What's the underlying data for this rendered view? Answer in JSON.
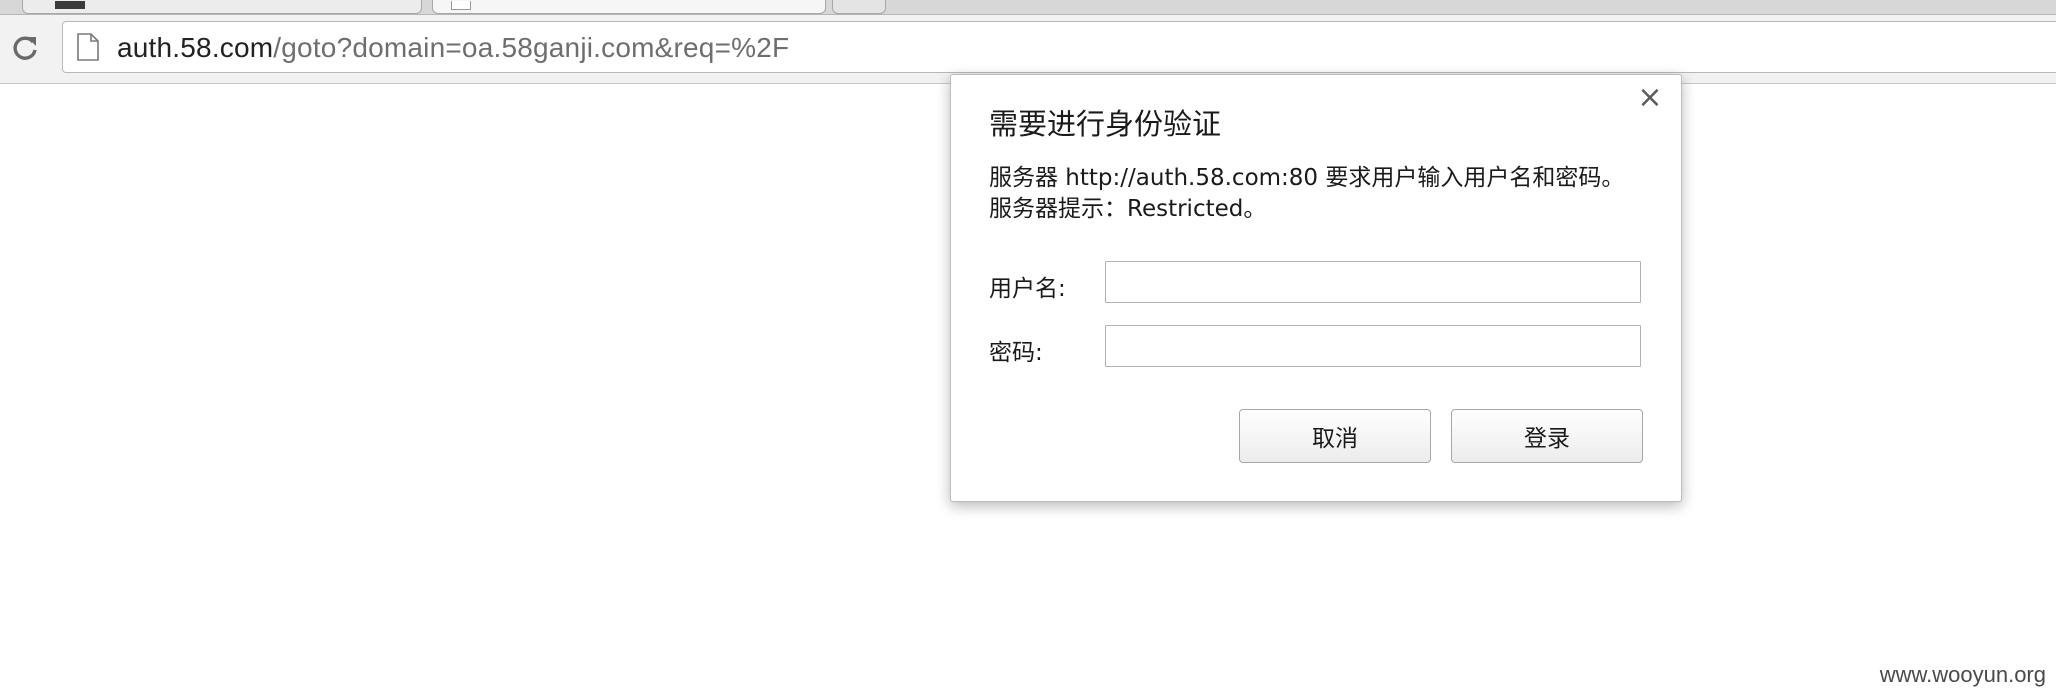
{
  "browser": {
    "tabs": [
      {
        "label": ""
      },
      {
        "label": ""
      },
      {
        "label": ""
      }
    ],
    "url": {
      "host": "auth.58.com",
      "path": "/goto?domain=oa.58ganji.com&req=%2F"
    },
    "icons": {
      "reload": "reload-icon",
      "page": "page-icon"
    }
  },
  "dialog": {
    "title": "需要进行身份验证",
    "message": "服务器 http://auth.58.com:80 要求用户输入用户名和密码。服务器提示：Restricted。",
    "close_label": "×",
    "username_label": "用户名:",
    "username_value": "",
    "password_label": "密码:",
    "password_value": "",
    "cancel_label": "取消",
    "login_label": "登录"
  },
  "watermark": "www.wooyun.org"
}
